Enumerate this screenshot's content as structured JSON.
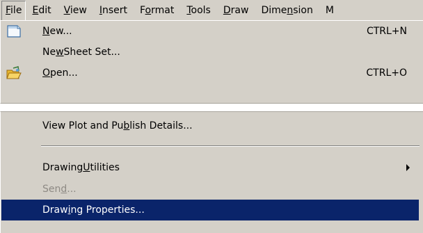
{
  "menubar": {
    "items": [
      {
        "label": "File",
        "underline": "F",
        "active": true
      },
      {
        "label": "Edit",
        "underline": "E"
      },
      {
        "label": "View",
        "underline": "V"
      },
      {
        "label": "Insert",
        "underline": "I"
      },
      {
        "label": "Format",
        "underline": "o"
      },
      {
        "label": "Tools",
        "underline": "T"
      },
      {
        "label": "Draw",
        "underline": "D"
      },
      {
        "label": "Dimension",
        "underline": "n"
      },
      {
        "label": "M",
        "underline": "M"
      }
    ]
  },
  "file_menu": {
    "new": {
      "pre": "",
      "ul": "N",
      "post": "ew...",
      "shortcut": "CTRL+N",
      "icon": "new-document-icon"
    },
    "new_sheet_set": {
      "pre": "Ne",
      "ul": "w",
      "post": " Sheet Set..."
    },
    "open": {
      "pre": "",
      "ul": "O",
      "post": "pen...",
      "shortcut": "CTRL+O",
      "icon": "open-folder-icon"
    },
    "view_plot": {
      "pre": "View Plot and Pu",
      "ul": "b",
      "post": "lish Details..."
    },
    "drawing_utilities": {
      "pre": "Drawing ",
      "ul": "U",
      "post": "tilities"
    },
    "send": {
      "pre": "Sen",
      "ul": "d",
      "post": "..."
    },
    "drawing_properties": {
      "pre": "Draw",
      "ul": "i",
      "post": "ng Properties..."
    }
  },
  "colors": {
    "menu_bg": "#d4d0c8",
    "highlight_bg": "#0a246a",
    "disabled_text": "#8e8a84"
  }
}
